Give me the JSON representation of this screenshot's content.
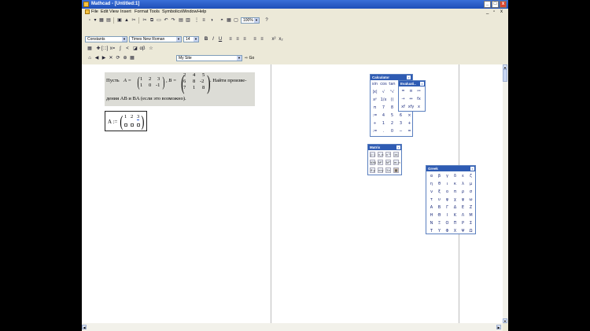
{
  "window": {
    "title": "Mathcad - [Untitled:1]"
  },
  "titlebar_buttons": [
    "_",
    "□",
    "x"
  ],
  "menu": {
    "items": [
      "File",
      "Edit",
      "View",
      "Insert",
      "Format",
      "Tools",
      "Symbolics",
      "Window",
      "Help"
    ],
    "doc_controls": [
      "_",
      "▫",
      "x"
    ]
  },
  "toolbar1": {
    "zoom": "100%",
    "icons": [
      "▫",
      "▾",
      "▦",
      "▤",
      "▣",
      "▲",
      "✂",
      "⧉",
      "▭",
      "✎",
      "↶",
      "↷",
      "▤",
      "▥",
      "⋮",
      "≡",
      "◑",
      "◓",
      "▦",
      "▢",
      "?"
    ]
  },
  "format_bar": {
    "style": "Constants",
    "font": "Times New Roman",
    "size": "14",
    "buttons": [
      "B",
      "I",
      "U",
      "≡",
      "≡",
      "≡",
      "≡",
      "≡",
      "x²",
      "x₂"
    ]
  },
  "math_bar": {
    "buttons": [
      "▦",
      "[:::]",
      "x=",
      "∫",
      "<",
      "αβ",
      "☆"
    ]
  },
  "resource_bar": {
    "url": "My Site",
    "go_label": "Go",
    "icons": [
      "⌂",
      "◀",
      "▶",
      "✕",
      "⟳",
      "⊕",
      "▦"
    ]
  },
  "scan_text": {
    "line1_a": "Пусть",
    "line1_A": "A =",
    "line1_B": ", B =",
    "line1_c": ". Найти произве-",
    "line2": "дения AB и BA (если это возможно).",
    "matrix_A": [
      "1",
      "2",
      "3",
      "1",
      "0",
      "-1"
    ],
    "matrix_B": [
      "2",
      "4",
      "5",
      "6",
      "8",
      "-2",
      "7",
      "1",
      "8"
    ]
  },
  "math_region": {
    "lhs": "A :=",
    "cells": [
      "1",
      "2",
      "3"
    ]
  },
  "calculator": {
    "title": "Calculator",
    "buttons": [
      "sin",
      "cos",
      "tan",
      "ln",
      "log",
      "n!",
      "|x|",
      "√",
      "ⁿ√",
      "eˣ",
      "1/x",
      "()",
      "π",
      "7",
      "8",
      "4",
      "5",
      "6",
      "1",
      "2",
      "3",
      ":=",
      ".",
      "0",
      "+",
      "−",
      "×",
      "÷",
      "x²",
      "xʸ",
      "=",
      "−"
    ]
  },
  "evaluation": {
    "title": "Evaluati..",
    "buttons": [
      "=",
      "≡",
      "≔",
      "→",
      "↔",
      "fx",
      "xf",
      "xfy",
      "x"
    ]
  },
  "matrix_palette": {
    "title": "Matrix",
    "buttons": [
      "[:::]",
      "x_n",
      "x⁻¹",
      "|x|",
      "f(M)",
      "M⁽⁾",
      "Mᵀ",
      "m..n",
      "x⃗·y",
      "x×y",
      "Σv",
      "▦"
    ]
  },
  "greek": {
    "title": "Greek",
    "letters": [
      "α",
      "β",
      "γ",
      "δ",
      "ε",
      "ζ",
      "η",
      "θ",
      "ι",
      "κ",
      "λ",
      "μ",
      "ν",
      "ξ",
      "ο",
      "π",
      "ρ",
      "σ",
      "τ",
      "υ",
      "φ",
      "χ",
      "ψ",
      "ω",
      "Α",
      "Β",
      "Γ",
      "Δ",
      "Ε",
      "Ζ",
      "Η",
      "Θ",
      "Ι",
      "Κ",
      "Λ",
      "Μ",
      "Ν",
      "Ξ",
      "Ο",
      "Π",
      "Ρ",
      "Σ",
      "Τ",
      "Υ",
      "Φ",
      "Χ",
      "Ψ",
      "Ω"
    ]
  },
  "scroll": {
    "up": "▲",
    "down": "▼",
    "left": "◀",
    "right": "▶"
  }
}
